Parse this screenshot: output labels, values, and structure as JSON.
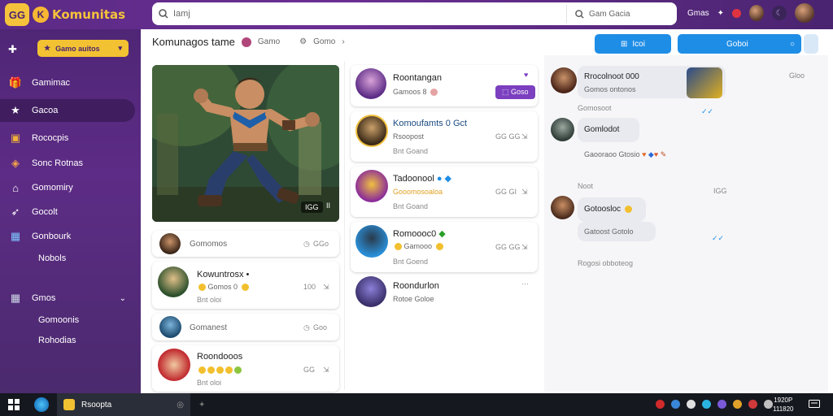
{
  "app": {
    "name": "Komunitas"
  },
  "topbar": {
    "search_placeholder": "Iamj",
    "search_secondary": "Gam Gacia",
    "right_label": "Gmas"
  },
  "sidebar": {
    "dropdown_label": "Gamo auitos",
    "items": [
      {
        "label": "Gamimac",
        "icon": "gift-icon"
      },
      {
        "label": "Gacoa",
        "icon": "star-icon",
        "active": true
      },
      {
        "label": "Rococpis",
        "icon": "treasure-icon"
      },
      {
        "label": "Sonc Rotnas",
        "icon": "box-icon"
      },
      {
        "label": "Gomomiry",
        "icon": "castle-icon"
      },
      {
        "label": "Gocolt",
        "icon": "rocket-icon"
      },
      {
        "label": "Gonbourk",
        "icon": "cube-icon"
      },
      {
        "label": "Nobols",
        "icon": "none"
      },
      {
        "label": "Gmos",
        "icon": "cube-icon",
        "expandable": true
      },
      {
        "label": "Gomoonis",
        "icon": "none"
      },
      {
        "label": "Rohodias",
        "icon": "none"
      }
    ]
  },
  "header": {
    "title": "Komunagos tame",
    "tag": "Gamo",
    "small": "Gomo",
    "btn1": "Icoi",
    "btn2": "Goboi"
  },
  "hero": {
    "tag_a": "IGG",
    "tag_b": "II"
  },
  "left_list": [
    {
      "name": "Gomomos",
      "meta": "GGo",
      "type": "compact"
    },
    {
      "name": "Kowuntrosx •",
      "sub": "Gomos 0",
      "meta": "100",
      "foot": "Bnt oloi",
      "type": "full"
    },
    {
      "name": "Gomanest",
      "meta": "Goo",
      "type": "compact"
    },
    {
      "name": "Roondooos",
      "sub": "",
      "meta": "GG",
      "foot": "Bnt oloi",
      "type": "full"
    }
  ],
  "mid_list": [
    {
      "name": "Roontangan",
      "sub": "Gamoos 8",
      "pill": "Goso"
    },
    {
      "name": "Komoufamts 0 Gct",
      "sub": "Rsoopost",
      "meta": "GG  GG",
      "foot": "Bnt Goand"
    },
    {
      "name": "Tadoonool",
      "sub": "Gooomosoaloa",
      "meta": "GG  GI",
      "foot": "Bnt Goand"
    },
    {
      "name": "Romoooc0",
      "sub": "Gamooo",
      "meta": "GG  GG",
      "foot": "Bnt Goend"
    },
    {
      "name": "Roondurlon",
      "sub": "Rotoe Goloe",
      "meta": "···"
    }
  ],
  "chat": [
    {
      "name": "Rrocolnoot 000",
      "lines": [
        "Gomos ontonos",
        "Gorosooc"
      ],
      "footer": "Gomosoot"
    },
    {
      "name": "Gomlodot",
      "lines": [
        "Gaooraoo Gtosio"
      ]
    },
    {
      "section": "Noot",
      "meta": "IGG"
    },
    {
      "name": "Gotoosloc",
      "lines": [
        "Gatoost Gotolo"
      ]
    },
    {
      "footer": "Rogosi obboteog"
    }
  ],
  "chat_meta_top": "Gloo",
  "taskbar": {
    "app_label": "Rsoopta",
    "clock_time": "1920P",
    "clock_date": "111820"
  }
}
